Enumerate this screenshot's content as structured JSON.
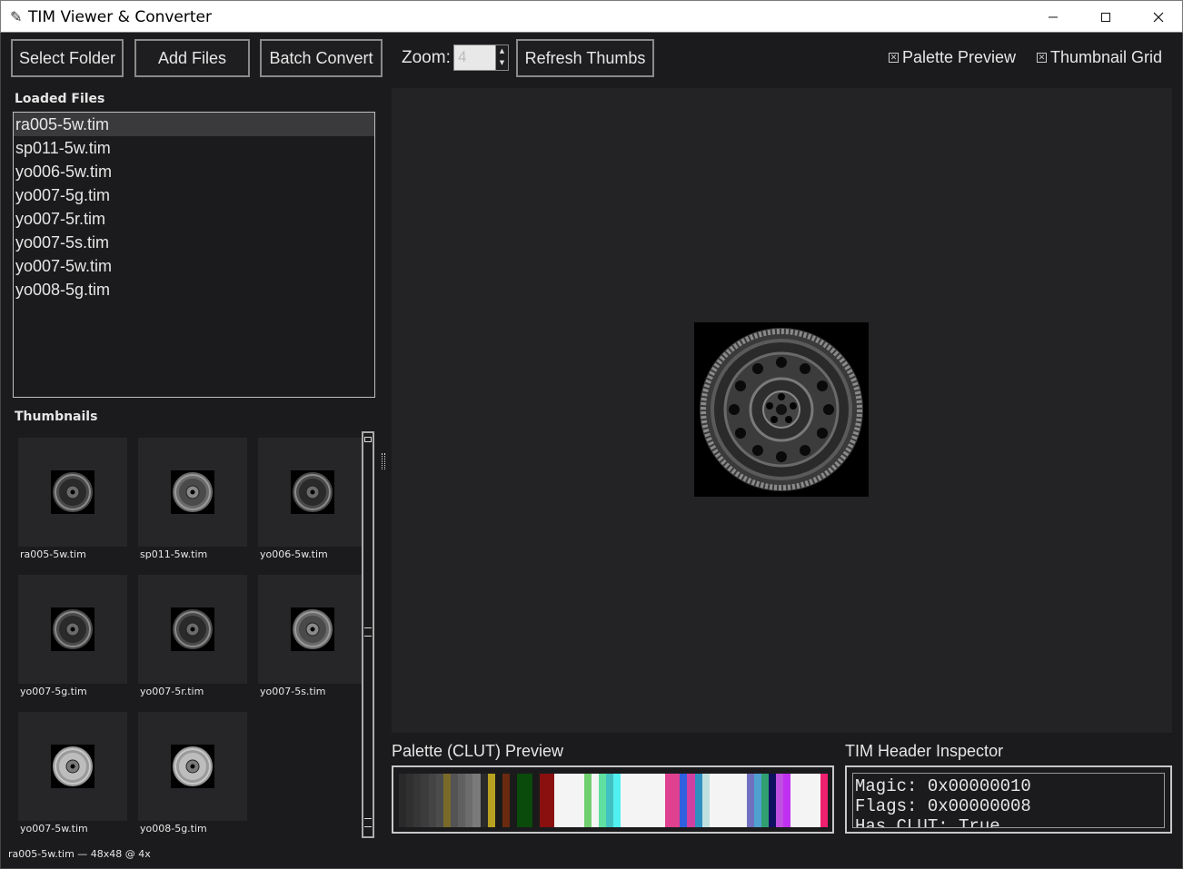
{
  "window": {
    "title": "TIM Viewer & Converter",
    "app_icon": "feather-icon",
    "minimize": "—",
    "maximize": "☐",
    "close": "✕"
  },
  "toolbar": {
    "select_folder": "Select Folder",
    "add_files": "Add Files",
    "batch_convert": "Batch Convert",
    "zoom_label": "Zoom:",
    "zoom_value": "4",
    "refresh_thumbs": "Refresh Thumbs",
    "palette_preview": {
      "label": "Palette Preview",
      "checked": true
    },
    "thumbnail_grid": {
      "label": "Thumbnail Grid",
      "checked": true
    }
  },
  "loaded_files": {
    "label": "Loaded Files",
    "selected_index": 0,
    "items": [
      "ra005-5w.tim",
      "sp011-5w.tim",
      "yo006-5w.tim",
      "yo007-5g.tim",
      "yo007-5r.tim",
      "yo007-5s.tim",
      "yo007-5w.tim",
      "yo008-5g.tim"
    ]
  },
  "thumbnails": {
    "label": "Thumbnails",
    "items": [
      {
        "name": "ra005-5w.tim",
        "style": "dark"
      },
      {
        "name": "sp011-5w.tim",
        "style": "mid"
      },
      {
        "name": "yo006-5w.tim",
        "style": "dark"
      },
      {
        "name": "yo007-5g.tim",
        "style": "dark"
      },
      {
        "name": "yo007-5r.tim",
        "style": "dark"
      },
      {
        "name": "yo007-5s.tim",
        "style": "mid"
      },
      {
        "name": "yo007-5w.tim",
        "style": "light"
      },
      {
        "name": "yo008-5g.tim",
        "style": "light"
      }
    ]
  },
  "palette": {
    "label": "Palette (CLUT) Preview",
    "colors": [
      "#2a2a2a",
      "#303030",
      "#363636",
      "#3c3c3c",
      "#444444",
      "#4c4c4c",
      "#7a6a2a",
      "#545454",
      "#606060",
      "#6c6c6c",
      "#7a7a7a",
      "#2a2a2a",
      "#b8a020",
      "#1a1a1a",
      "#6a2a10",
      "#1a1a1a",
      "#0a4a0a",
      "#0a4a0a",
      "#1a1a1a",
      "#8a1010",
      "#8a1010",
      "#f4f4f4",
      "#f4f4f4",
      "#f4f4f4",
      "#f4f4f4",
      "#70d070",
      "#f4f4f4",
      "#60e0a0",
      "#40c0c0",
      "#50f0f0",
      "#f4f4f4",
      "#f4f4f4",
      "#f4f4f4",
      "#f4f4f4",
      "#f4f4f4",
      "#f4f4f4",
      "#e04090",
      "#e04090",
      "#3060e0",
      "#d040a0",
      "#3090c0",
      "#c0e0e0",
      "#f4f4f4",
      "#f4f4f4",
      "#f4f4f4",
      "#f4f4f4",
      "#f4f4f4",
      "#7070c0",
      "#50a0d0",
      "#30a070",
      "#101060",
      "#c050e0",
      "#c030f0",
      "#f4f4f4",
      "#f4f4f4",
      "#f4f4f4",
      "#f4f4f4",
      "#f02070"
    ]
  },
  "inspector": {
    "label": "TIM Header Inspector",
    "lines": [
      "Magic: 0x00000010",
      "Flags: 0x00000008",
      "Has CLUT: True"
    ]
  },
  "status": {
    "text": "ra005-5w.tim  —  48x48 @ 4x"
  }
}
